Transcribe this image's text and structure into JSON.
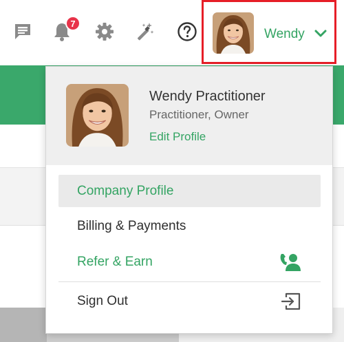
{
  "colors": {
    "accent_green": "#34a463",
    "band_green": "#3aa86b",
    "badge_red": "#e8334a",
    "highlight_red": "#e61e27",
    "icon_grey": "#8a8a8a"
  },
  "topbar": {
    "icons": [
      "chat-icon",
      "bell-icon",
      "gear-icon",
      "magic-wand-icon",
      "help-icon"
    ],
    "notification_count": "7",
    "user": {
      "name": "Wendy",
      "avatar": "user-avatar",
      "chevron": "chevron-down-icon"
    }
  },
  "dropdown": {
    "profile": {
      "full_name": "Wendy Practitioner",
      "role": "Practitioner, Owner",
      "edit_label": "Edit Profile"
    },
    "items": [
      {
        "label": "Company Profile",
        "active": true
      },
      {
        "label": "Billing & Payments"
      },
      {
        "label": "Refer & Earn",
        "icon": "refer-user-icon"
      },
      {
        "label": "Sign Out",
        "icon": "sign-out-icon"
      }
    ]
  }
}
